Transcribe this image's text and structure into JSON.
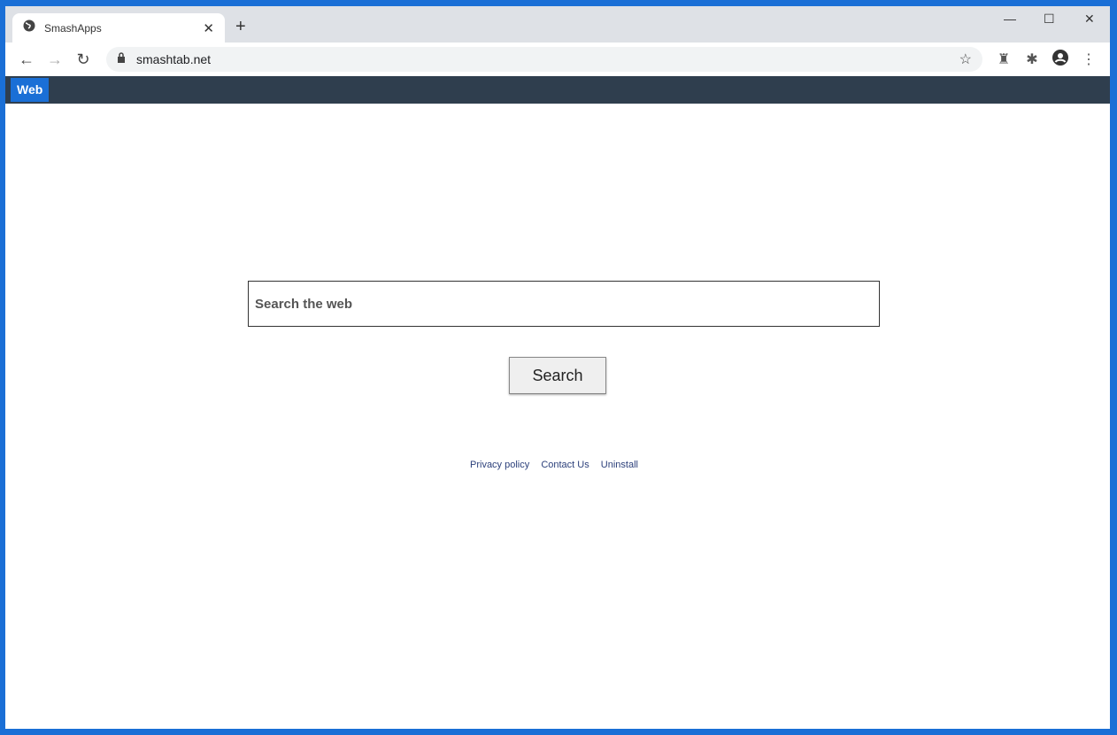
{
  "browser": {
    "tab_title": "SmashApps",
    "url": "smashtab.net"
  },
  "site": {
    "nav_tab": "Web",
    "search_placeholder": "Search the web",
    "search_button": "Search",
    "links": [
      "Privacy policy",
      "Contact Us",
      "Uninstall"
    ]
  }
}
